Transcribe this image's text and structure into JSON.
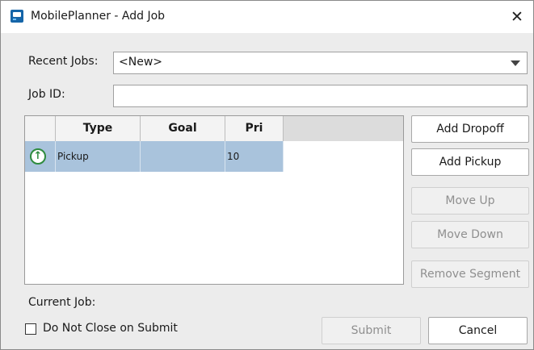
{
  "window": {
    "title": "MobilePlanner - Add Job",
    "close_symbol": "✕"
  },
  "form": {
    "recent_jobs_label": "Recent Jobs:",
    "recent_jobs_value": "<New>",
    "job_id_label": "Job ID:",
    "job_id_value": ""
  },
  "table": {
    "columns": [
      "",
      "Type",
      "Goal",
      "Pri"
    ],
    "rows": [
      {
        "icon": "green-up-arrow-icon",
        "icon_glyph": "↑",
        "type": "Pickup",
        "goal": "",
        "pri": "10",
        "selected": true
      }
    ]
  },
  "buttons": {
    "add_dropoff": "Add Dropoff",
    "add_pickup": "Add Pickup",
    "move_up": "Move Up",
    "move_down": "Move Down",
    "remove_segment": "Remove Segment",
    "submit": "Submit",
    "cancel": "Cancel"
  },
  "footer": {
    "current_job_label": "Current Job:",
    "do_not_close_label": "Do Not Close on Submit",
    "do_not_close_checked": false
  },
  "colors": {
    "selection": "#a9c3dc",
    "app_icon": "#1565a8",
    "status_green": "#2e8b3e"
  }
}
